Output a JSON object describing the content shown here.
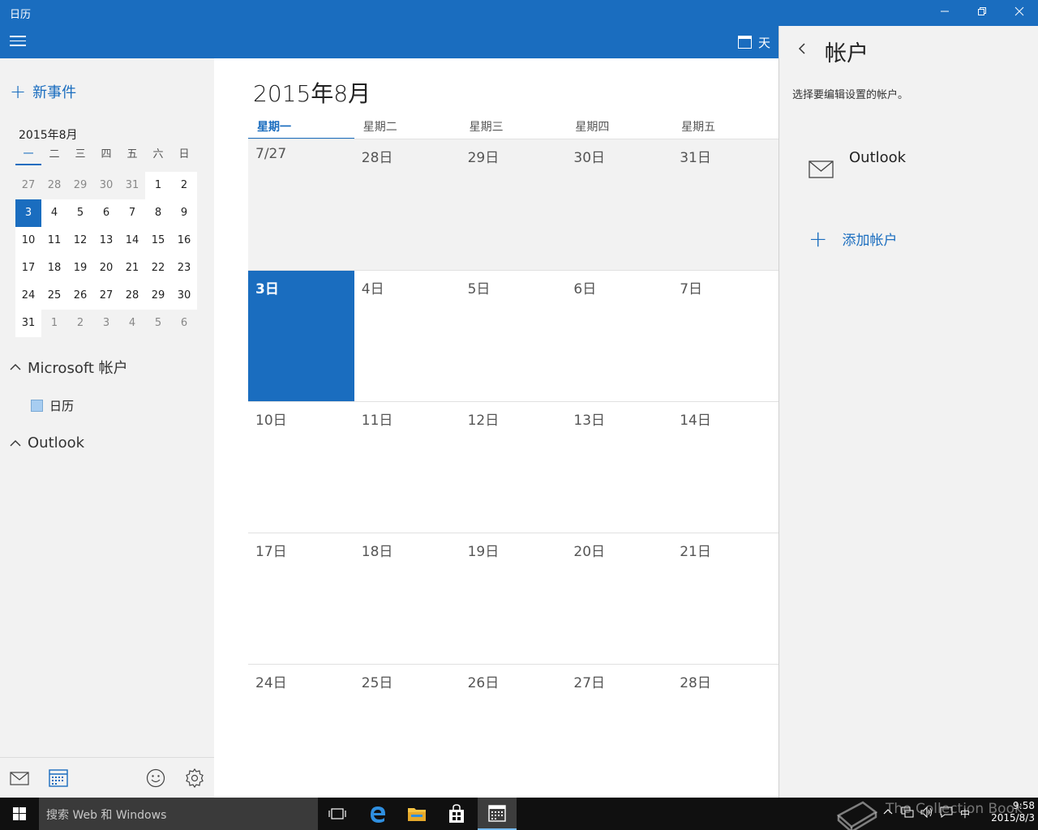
{
  "window": {
    "title": "日历",
    "minimize": "–",
    "restore": "❐",
    "close": "✕"
  },
  "appbar": {
    "view_label": "天"
  },
  "left": {
    "new_event": "新事件",
    "mini_calendar": {
      "month_label": "2015年8月",
      "weekdays": [
        "一",
        "二",
        "三",
        "四",
        "五",
        "六",
        "日"
      ],
      "weeks": [
        [
          "27",
          "28",
          "29",
          "30",
          "31",
          "1",
          "2"
        ],
        [
          "3",
          "4",
          "5",
          "6",
          "7",
          "8",
          "9"
        ],
        [
          "10",
          "11",
          "12",
          "13",
          "14",
          "15",
          "16"
        ],
        [
          "17",
          "18",
          "19",
          "20",
          "21",
          "22",
          "23"
        ],
        [
          "24",
          "25",
          "26",
          "27",
          "28",
          "29",
          "30"
        ],
        [
          "31",
          "1",
          "2",
          "3",
          "4",
          "5",
          "6"
        ]
      ],
      "today": "3"
    },
    "groups": {
      "microsoft": "Microsoft 帐户",
      "calendar_entry": "日历",
      "outlook": "Outlook"
    }
  },
  "main": {
    "month_title": "2015年8月",
    "weekdays": [
      "星期一",
      "星期二",
      "星期三",
      "星期四",
      "星期五"
    ],
    "weeks": [
      [
        "7/27",
        "28日",
        "29日",
        "30日",
        "31日"
      ],
      [
        "3日",
        "4日",
        "5日",
        "6日",
        "7日"
      ],
      [
        "10日",
        "11日",
        "12日",
        "13日",
        "14日"
      ],
      [
        "17日",
        "18日",
        "19日",
        "20日",
        "21日"
      ],
      [
        "24日",
        "25日",
        "26日",
        "27日",
        "28日"
      ]
    ]
  },
  "accounts_pane": {
    "title": "帐户",
    "hint": "选择要编辑设置的帐户。",
    "account_name": "Outlook",
    "add_account": "添加帐户"
  },
  "taskbar": {
    "search_placeholder": "搜索 Web 和 Windows",
    "tray_ime": "中",
    "time": "9:58",
    "date": "2015/8/3"
  },
  "watermark": "The Collection Book",
  "colors": {
    "accent": "#1a6dbf",
    "pane_bg": "#f2f2f2",
    "taskbar": "#101010"
  }
}
